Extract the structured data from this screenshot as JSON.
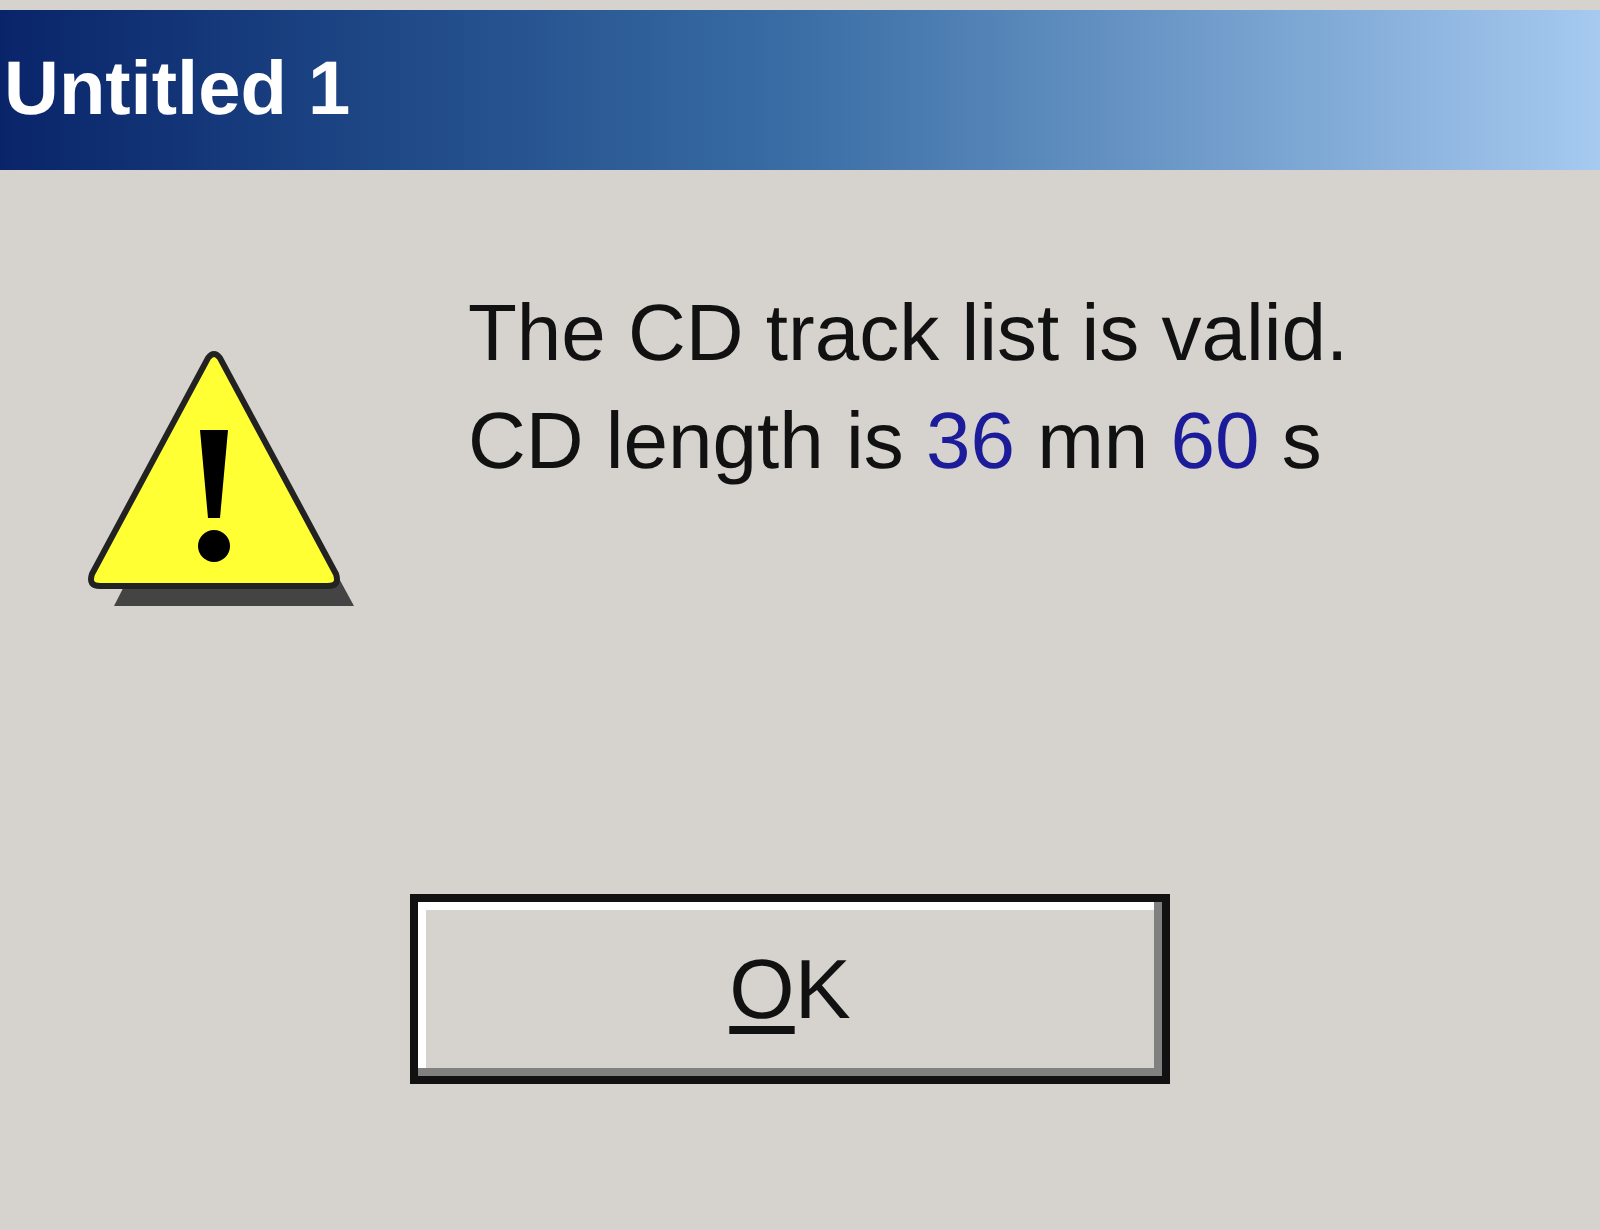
{
  "window": {
    "title": "Untitled 1"
  },
  "message": {
    "kind": "warning",
    "lines": [
      [
        {
          "kind": "plain",
          "text": "The CD track list is valid."
        }
      ],
      [
        {
          "kind": "plain",
          "text": "CD length is "
        },
        {
          "kind": "value",
          "text": "36"
        },
        {
          "kind": "plain",
          "text": " mn "
        },
        {
          "kind": "value",
          "text": "60"
        },
        {
          "kind": "plain",
          "text": " s"
        }
      ]
    ]
  },
  "button": {
    "accelerator": "O",
    "label_rest": "K"
  }
}
